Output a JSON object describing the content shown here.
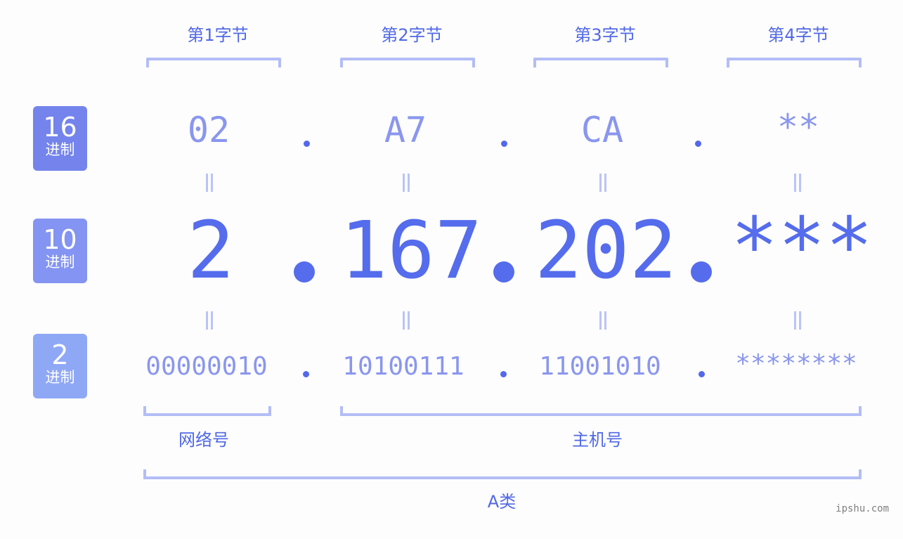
{
  "bytes": [
    {
      "label": "第1字节",
      "hex": "02",
      "dec": "2",
      "bin": "00000010"
    },
    {
      "label": "第2字节",
      "hex": "A7",
      "dec": "167",
      "bin": "10100111"
    },
    {
      "label": "第3字节",
      "hex": "CA",
      "dec": "202",
      "bin": "11001010"
    },
    {
      "label": "第4字节",
      "hex": "**",
      "dec": "***",
      "bin": "********"
    }
  ],
  "rows": [
    {
      "base": "16",
      "unit": "进制",
      "color": "#7484ec"
    },
    {
      "base": "10",
      "unit": "进制",
      "color": "#8494f2"
    },
    {
      "base": "2",
      "unit": "进制",
      "color": "#8fa8f6"
    }
  ],
  "equals_symbol": "||",
  "parts": {
    "network": "网络号",
    "host": "主机号",
    "class": "A类"
  },
  "watermark": "ipshu.com",
  "colors": {
    "primary": "#556cec",
    "secondary": "#8a96ee",
    "bracket": "#b3bdf6"
  }
}
